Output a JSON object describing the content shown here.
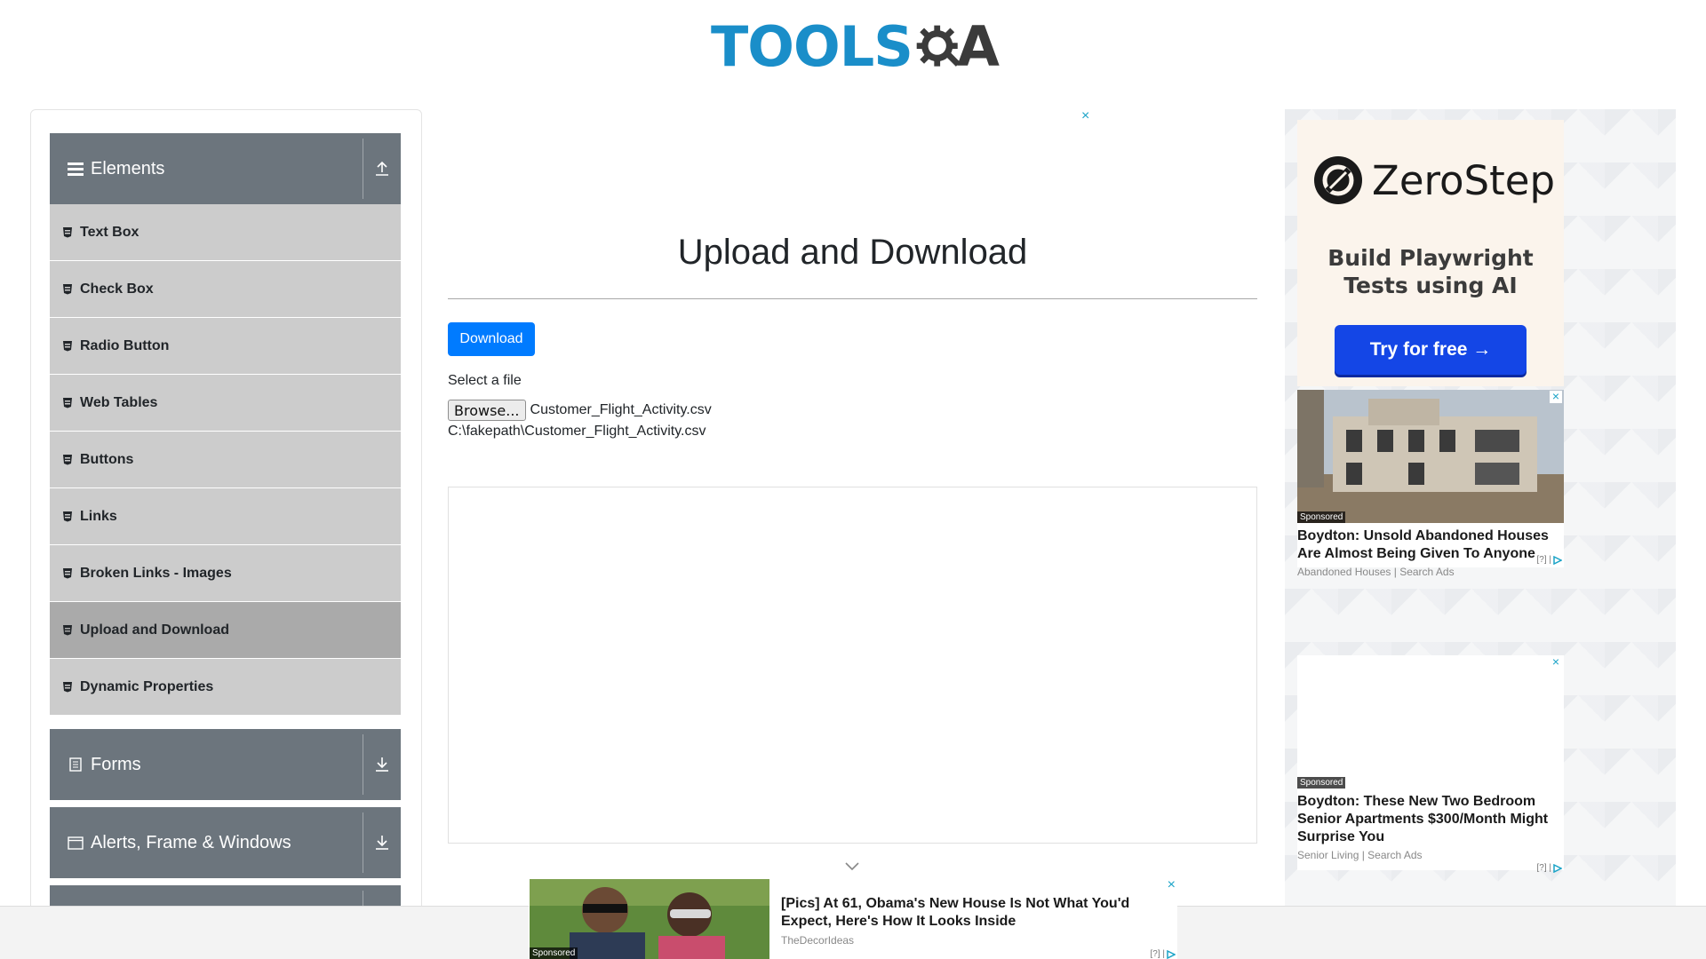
{
  "header": {
    "logo_word": "TOOLS",
    "logo_letter": "A"
  },
  "sidebar": {
    "groups": [
      {
        "title": "Elements",
        "expanded": true,
        "icon": "hamburger-icon",
        "arrow": "collapse-up-icon"
      },
      {
        "title": "Forms",
        "expanded": false,
        "icon": "document-icon",
        "arrow": "expand-down-icon"
      },
      {
        "title": "Alerts, Frame & Windows",
        "expanded": false,
        "icon": "window-icon",
        "arrow": "expand-down-icon"
      }
    ],
    "items": [
      {
        "label": "Text Box"
      },
      {
        "label": "Check Box"
      },
      {
        "label": "Radio Button"
      },
      {
        "label": "Web Tables"
      },
      {
        "label": "Buttons"
      },
      {
        "label": "Links"
      },
      {
        "label": "Broken Links - Images"
      },
      {
        "label": "Upload and Download",
        "active": true
      },
      {
        "label": "Dynamic Properties"
      }
    ]
  },
  "main": {
    "title": "Upload and Download",
    "download_label": "Download",
    "select_label": "Select a file",
    "browse_label": "Browse...",
    "selected_file": "Customer_Flight_Activity.csv",
    "uploaded_path": "C:\\fakepath\\Customer_Flight_Activity.csv",
    "ad_close": "×"
  },
  "right_ads": {
    "zerostep": {
      "name": "ZeroStep",
      "tagline_line1": "Build Playwright",
      "tagline_line2": "Tests using AI",
      "cta": "Try for free →"
    },
    "ad1": {
      "sponsored": "Sponsored",
      "headline": "Boydton: Unsold Abandoned Houses Are Almost Being Given To Anyone",
      "source": "Abandoned Houses | Search Ads",
      "choices": "[?] |"
    },
    "ad2": {
      "sponsored": "Sponsored",
      "headline": "Boydton: These New Two Bedroom Senior Apartments $300/Month Might Surprise You",
      "source": "Senior Living | Search Ads",
      "choices": "[?] |"
    }
  },
  "bottom_ad": {
    "sponsored": "Sponsored",
    "headline": "[Pics] At 61, Obama's New House Is Not What You'd Expect, Here's How It Looks Inside",
    "source": "TheDecorIdeas",
    "choices": "[?] |",
    "close": "×"
  },
  "colors": {
    "primary": "#007bff",
    "sidebar_header": "#6c757d",
    "sidebar_item": "#cccccc",
    "sidebar_item_active": "#aaaaaa",
    "logo_blue": "#1a8ec9",
    "ad_accent": "#1aa3c7",
    "zerostep_cta": "#1446e6"
  }
}
